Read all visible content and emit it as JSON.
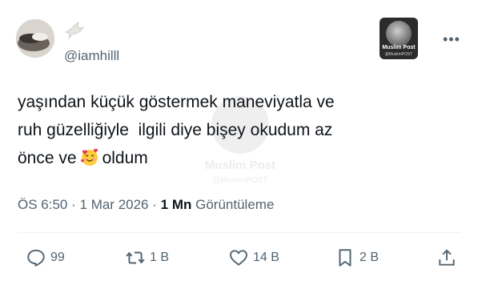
{
  "author": {
    "handle": "@iamhilll",
    "name_emoji": "dove-emoji"
  },
  "badge": {
    "title": "Muslim Post",
    "subtitle": "@MuslimPOST"
  },
  "menu": {
    "more_label": "•••"
  },
  "tweet": {
    "line1": "yaşından küçük göstermek maneviyatla ve",
    "line2": "ruh güzelliğiyle  ilgili diye bişey okudum az",
    "line3_before": "önce ve",
    "line3_after": "oldum",
    "emoji": "smiling-face-with-hearts"
  },
  "watermark": {
    "title": "Muslim Post",
    "subtitle": "@MuslimPOST"
  },
  "meta": {
    "time": "ÖS 6:50",
    "separator": "·",
    "date": "1 Mar 2026",
    "views_count": "1 Mn",
    "views_label": "Görüntüleme"
  },
  "actions": {
    "reply": {
      "count": "99",
      "icon": "reply-icon"
    },
    "retweet": {
      "count": "1 B",
      "icon": "retweet-icon"
    },
    "like": {
      "count": "14 B",
      "icon": "heart-icon"
    },
    "bookmark": {
      "count": "2 B",
      "icon": "bookmark-icon"
    },
    "share": {
      "icon": "share-icon"
    }
  },
  "colors": {
    "text": "#0f1419",
    "secondary": "#536471",
    "divider": "#eff3f4"
  }
}
